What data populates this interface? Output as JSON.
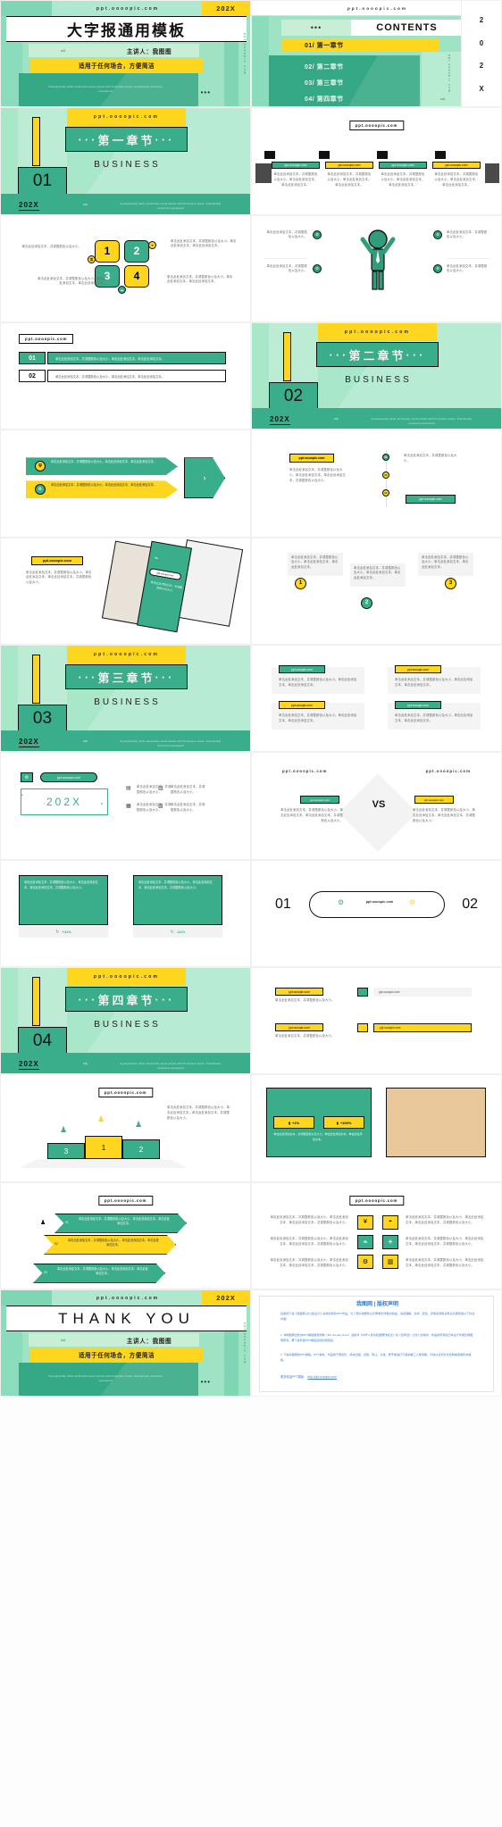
{
  "brand": {
    "url": "ppt.oooopic.com",
    "url_plain": "ppt.oooopic.com",
    "year": "202X",
    "colors": {
      "green_dark": "#3aad8a",
      "green_mid": "#7fd6b4",
      "green_light": "#9fe3c5",
      "green_pale": "#c8efd6",
      "yellow": "#ffd61e",
      "black": "#111111",
      "white": "#ffffff"
    }
  },
  "cover": {
    "url": "ppt.oooopic.com",
    "year": "202X",
    "title": "大字报通用模板",
    "arrow_icon": "arrow-right-icon",
    "speaker": "主讲人：我图图",
    "subtitle": "适用于任何场合，方便简洁",
    "english": "Synergistically utilize technically sound portals with frictionless chains. Dramatically customize empowered",
    "side_text": "ppt.oooopic.com",
    "dots": "•••"
  },
  "contents": {
    "url": "ppt.oooopic.com",
    "dots": "•••",
    "heading": "CONTENTS",
    "items": [
      {
        "label": "01/ 第一章节"
      },
      {
        "label": "02/ 第二章节"
      },
      {
        "label": "03/ 第三章节"
      },
      {
        "label": "04/ 第四章节"
      }
    ],
    "year_chars": [
      "2",
      "0",
      "2",
      "X"
    ],
    "side_text": "ppt.oooopic.com",
    "arrow_icon": "arrow-right-icon",
    "close_icon": "close-icon"
  },
  "chapters": [
    {
      "num": "01",
      "title": "第一章节",
      "sub": "BUSINESS",
      "url": "ppt.oooopic.com",
      "year": "202X",
      "english": "Synergistically utilize technically sound portals with frictionless chains. Dramatically customize empowered",
      "dots": "···"
    },
    {
      "num": "02",
      "title": "第二章节",
      "sub": "BUSINESS",
      "url": "ppt.oooopic.com",
      "year": "202X",
      "english": "Synergistically utilize technically sound portals with frictionless chains. Dramatically customize empowered",
      "dots": "···"
    },
    {
      "num": "03",
      "title": "第三章节",
      "sub": "BUSINESS",
      "url": "ppt.oooopic.com",
      "year": "202X",
      "english": "Synergistically utilize technically sound portals with frictionless chains. Dramatically customize empowered",
      "dots": "···"
    },
    {
      "num": "04",
      "title": "第四章节",
      "sub": "BUSINESS",
      "url": "ppt.oooopic.com",
      "year": "202X",
      "english": "Synergistically utilize technically sound portals with frictionless chains. Dramatically customize empowered",
      "dots": "···"
    }
  ],
  "placeholder": {
    "body": "单击此处添加文本，并调整颜色以及大小。单击此处添加文本，单击此处添加文本。",
    "body_short": "单击此处添加文本，并调整颜色以及大小。",
    "body_long": "单击此处添加文本，并调整颜色以及大小。单击此处添加文本，单击此处添加文本，并调整颜色以及大小。"
  },
  "slide_columns4": {
    "url": "ppt.oooopic.com",
    "items": [
      {
        "label": "ppt.oooopic.com",
        "style": "green",
        "icon": "bank-icon"
      },
      {
        "label": "ppt.oooopic.com",
        "style": "yellow",
        "icon": "bank-icon"
      },
      {
        "label": "ppt.oooopic.com",
        "style": "green",
        "icon": "bank-icon"
      },
      {
        "label": "ppt.oooopic.com",
        "style": "yellow",
        "icon": "bank-icon"
      }
    ]
  },
  "slide_squares": {
    "numbers": [
      "1",
      "2",
      "3",
      "4"
    ],
    "icons": [
      "key-icon",
      "leaf-icon",
      "cloud-icon",
      "star-icon"
    ]
  },
  "slide_person": {
    "person_icon": "person-celebrating-icon",
    "node_icon": "gear-icon",
    "nodes": 4
  },
  "slide_list2": {
    "url": "ppt.oooopic.com",
    "rows": [
      {
        "num": "01",
        "tag": "ppt.oooopic.com"
      },
      {
        "num": "02",
        "tag": ""
      }
    ]
  },
  "slide_arrows": {
    "shield_icon": "shield-icon",
    "gear_icon": "gear-icon",
    "arrow_icon": "chevron-right-icon"
  },
  "slide_timeline": {
    "url": "ppt.oooopic.com",
    "entries": [
      "01",
      "02",
      "03"
    ],
    "tag": "ppt.oooopic.com"
  },
  "slide_photos": {
    "tag": "ppt.oooopic.com",
    "chart_icon": "line-chart-icon",
    "inner_tag": "ppt.oooopic.com"
  },
  "slide_bubbles": {
    "bubbles": [
      {
        "num": "1",
        "color": "yellow"
      },
      {
        "num": "2",
        "color": "green"
      },
      {
        "num": "3",
        "color": "yellow"
      }
    ]
  },
  "slide_fourtags": {
    "tags": [
      "ppt.oooopic.com",
      "ppt.oooopic.com",
      "ppt.oooopic.com",
      "ppt.oooopic.com"
    ]
  },
  "slide_year": {
    "url": "ppt.oooopic.com",
    "gear_icon": "gear-icon",
    "year": "202X",
    "small_icons": [
      "laptop-icon",
      "chart-icon",
      "doc-icon",
      "cloud-icon"
    ]
  },
  "slide_vs": {
    "left_url": "ppt.oooopic.com",
    "right_url": "ppt.oooopic.com",
    "left_tag": "ppt.oooopic.com",
    "right_tag": "ppt.oooopic.com",
    "vs": "VS"
  },
  "slide_cards2": {
    "percent_left": "+41%",
    "percent_right": "-61%",
    "icon": "refresh-icon"
  },
  "slide_pillnums": {
    "left": "01",
    "right": "02",
    "url": "ppt.oooopic.com",
    "gear_icon": "gear-icon"
  },
  "slide_tagged": {
    "url": "ppt.oooopic.com",
    "tags": [
      "ppt.oooopic.com",
      "ppt.oooopic.com",
      "ppt.oooopic.com",
      "ppt.oooopic.com"
    ]
  },
  "slide_podium": {
    "url": "ppt.oooopic.com",
    "ranks": [
      "3",
      "1",
      "2"
    ],
    "icon": "person-icon"
  },
  "slide_image_stats": {
    "left_pct": "+1%",
    "right_pct": "+100%",
    "icon": "coins-icon"
  },
  "slide_chevrons": {
    "url": "ppt.oooopic.com",
    "rows": [
      {
        "num": "01",
        "style": "green"
      },
      {
        "num": "02",
        "style": "yellow"
      },
      {
        "num": "03",
        "style": "green"
      }
    ]
  },
  "slide_icons6": {
    "url": "ppt.oooopic.com",
    "icons": [
      "yen-icon",
      "ink-icon",
      "leaf-icon",
      "bulb-icon",
      "gear-icon",
      "chart-icon"
    ]
  },
  "thank_you": {
    "url": "ppt.oooopic.com",
    "year": "202X",
    "title": "THANK YOU",
    "arrow_icon": "arrow-right-icon",
    "speaker": "主讲人：我图图",
    "subtitle": "适用于任何场合，方便简洁",
    "english": "Synergistically utilize technically sound portals with frictionless chains. Dramatically customize empowered",
    "side_text": "ppt.oooopic.com",
    "dots": "•••"
  },
  "copyright": {
    "title": "我图网 | 版权声明",
    "p1": "感谢您下载【我图网-办公加设计】提供的原创PPT作品。为了更好地服务以及尊重创作者的权益，请您理解、支持、配合，您购买授权请务必仔细阅读以下协议内容！",
    "p2": "1. 本网图网出售的PPT模板服务限制（RF, Royalty-Free）适用对《中华人民共和国著作权法》和《合同法》公约》的保护，作品的所有权归本设计作者及网图网所有。著下载处属PPT模板最终的使用权。",
    "p3": "2. 不得将图网的PPT模板、PPT素材、作品用于再出售、成本出租、出借、转让、分发、赠予或进行与其他第三人使用等。不得以任何方式复制或者销售本模板。",
    "more": "更多精品PPT模板：",
    "link": "http://ppt.oooopic.com"
  }
}
